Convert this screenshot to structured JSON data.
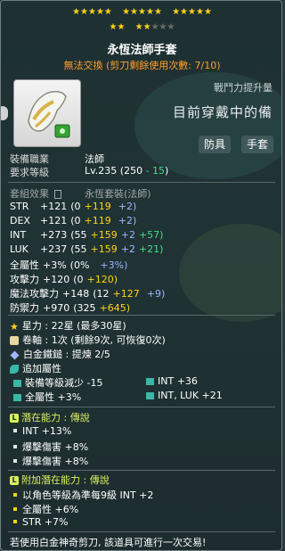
{
  "star_rows": [
    {
      "groups": [
        {
          "on": 5,
          "off": 0
        },
        {
          "on": 5,
          "off": 0
        },
        {
          "on": 5,
          "off": 0
        }
      ]
    },
    {
      "groups": [
        {
          "on": 2,
          "off": 0
        },
        {
          "on": 2,
          "off": 3
        }
      ]
    }
  ],
  "title": "永恆法師手套",
  "subtitle": "無法交換 (剪刀剩餘使用次數: 7/10)",
  "combat_power_label": "戰鬥力提升量",
  "equipped_text": "目前穿戴中的備",
  "tags": [
    "防具",
    "手套"
  ],
  "job": {
    "label": "裝備職業",
    "value": "法師"
  },
  "level": {
    "label": "要求等級",
    "value": "Lv.235",
    "paren_open": "(250",
    "minus": "- 15",
    "paren_close": ")"
  },
  "set": {
    "label": "套組效果",
    "value": "永恆套裝(法師)"
  },
  "stats": [
    {
      "name": "STR",
      "total": "+121",
      "base": "(0",
      "star": "+119",
      "flame": "",
      "other": "+2)",
      "flame_color": ""
    },
    {
      "name": "DEX",
      "total": "+121",
      "base": "(0",
      "star": "+119",
      "flame": "",
      "other": "+2)",
      "flame_color": ""
    },
    {
      "name": "INT",
      "total": "+273",
      "base": "(55",
      "star": "+159",
      "flame": "+2",
      "other": "+57)",
      "flame_color": "blue"
    },
    {
      "name": "LUK",
      "total": "+237",
      "base": "(55",
      "star": "+159",
      "flame": "+2",
      "other": "+21)",
      "flame_color": "blue"
    },
    {
      "name": "全屬性",
      "total": "+3%",
      "base": "(0%",
      "star": "",
      "flame": "",
      "other": "+3%)",
      "flame_color": ""
    },
    {
      "name": "攻擊力",
      "total": "+120",
      "base": "(0",
      "star": "+120)",
      "flame": "",
      "other": "",
      "flame_color": ""
    },
    {
      "name": "魔法攻擊力",
      "total": "+148",
      "base": "(12",
      "star": "+127",
      "flame": "",
      "other": "+9)",
      "flame_color": ""
    },
    {
      "name": "防禦力",
      "total": "+970",
      "base": "(325",
      "star": "+645)",
      "flame": "",
      "other": "",
      "flame_color": ""
    }
  ],
  "star_force": {
    "label": "星力 : 22星 (最多30星)"
  },
  "scroll": {
    "label": "卷軸 : 1次 (剩餘9次, 可恢復0次)"
  },
  "hammer": {
    "label": "白金鐵鎚 : 提煉 2/5"
  },
  "additional_title": "追加屬性",
  "additional": [
    {
      "text": "裝備等級減少 -15"
    },
    {
      "text": "INT +36"
    },
    {
      "text": "全屬性 +3%"
    },
    {
      "text": "INT, LUK +21"
    }
  ],
  "potential": {
    "badge": "L",
    "title": "潛在能力 : 傳說",
    "lines": [
      "INT +13%",
      "爆擊傷害 +8%",
      "爆擊傷害 +8%"
    ]
  },
  "bonus_potential": {
    "badge": "L",
    "title": "附加潛在能力 : 傳說",
    "lines": [
      "以角色等級為準每9級 INT +2",
      "全屬性 +6%",
      "STR +7%"
    ]
  },
  "footer": "若使用白金神奇剪刀, 該道具可進行一次交易!",
  "colors": {
    "star": "#ffd21a",
    "orange": "#ff9f2a",
    "blue": "#9fb5ff",
    "green": "#38e28a",
    "legendary": "#d9f05e"
  }
}
